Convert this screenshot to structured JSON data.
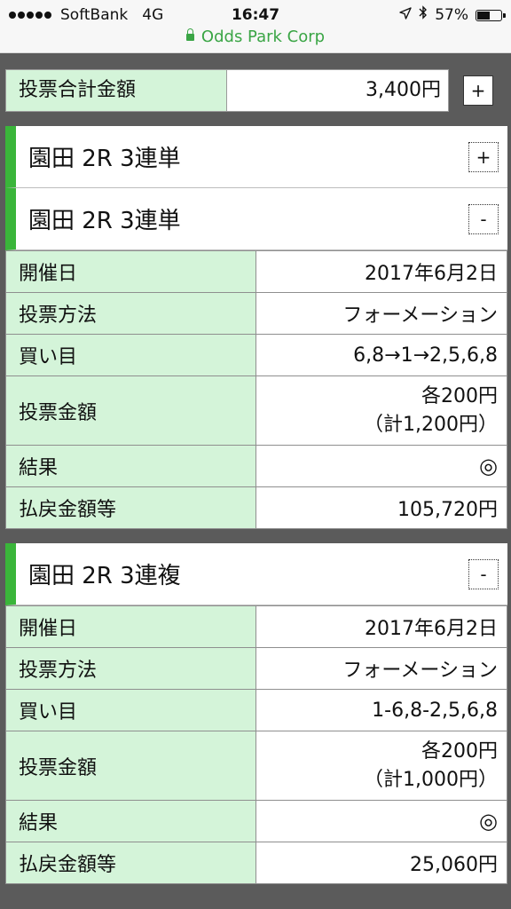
{
  "status_bar": {
    "carrier": "SoftBank",
    "network": "4G",
    "time": "16:47",
    "battery": "57%",
    "battery_level": 0.57,
    "url": "Odds Park Corp"
  },
  "summary": {
    "label": "投票合計金額",
    "amount": "3,400円",
    "toggle": "+"
  },
  "races": [
    {
      "title": "園田 2R 3連単",
      "toggle": "+"
    },
    {
      "title": "園田 2R 3連単",
      "toggle": "-",
      "rows": [
        {
          "label": "開催日",
          "value": "2017年6月2日"
        },
        {
          "label": "投票方法",
          "value": "フォーメーション"
        },
        {
          "label": "買い目",
          "value": "6,8→1→2,5,6,8"
        },
        {
          "label": "投票金額",
          "value": "各200円",
          "value2": "（計1,200円）"
        },
        {
          "label": "結果",
          "value": "◎"
        },
        {
          "label": "払戻金額等",
          "value": "105,720円"
        }
      ]
    },
    {
      "title": "園田 2R 3連複",
      "toggle": "-",
      "rows": [
        {
          "label": "開催日",
          "value": "2017年6月2日"
        },
        {
          "label": "投票方法",
          "value": "フォーメーション"
        },
        {
          "label": "買い目",
          "value": "1-6,8-2,5,6,8"
        },
        {
          "label": "投票金額",
          "value": "各200円",
          "value2": "（計1,000円）"
        },
        {
          "label": "結果",
          "value": "◎"
        },
        {
          "label": "払戻金額等",
          "value": "25,060円"
        }
      ]
    }
  ],
  "colors": {
    "label_bg": "#d4f4d9",
    "accent_green": "#3ab53a",
    "page_bg": "#5b5b5b",
    "url_green": "#3aa545"
  }
}
